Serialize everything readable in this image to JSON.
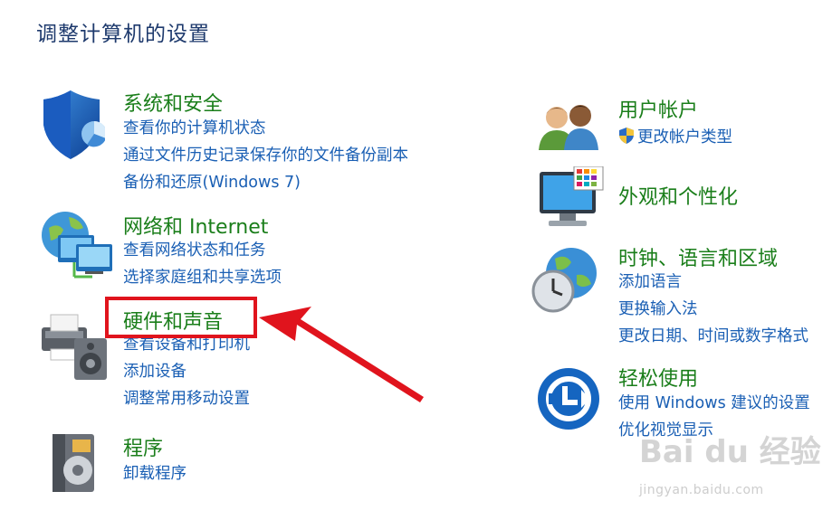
{
  "page": {
    "title": "调整计算机的设置"
  },
  "left_categories": [
    {
      "title": "系统和安全",
      "icon": "shield-icon",
      "links": [
        "查看你的计算机状态",
        "通过文件历史记录保存你的文件备份副本",
        "备份和还原(Windows 7)"
      ]
    },
    {
      "title": "网络和 Internet",
      "icon": "network-globe-icon",
      "links": [
        "查看网络状态和任务",
        "选择家庭组和共享选项"
      ]
    },
    {
      "title": "硬件和声音",
      "icon": "printer-speaker-icon",
      "links": [
        "查看设备和打印机",
        "添加设备",
        "调整常用移动设置"
      ]
    },
    {
      "title": "程序",
      "icon": "programs-disc-icon",
      "links": [
        "卸载程序"
      ]
    }
  ],
  "right_categories": [
    {
      "title": "用户帐户",
      "icon": "users-icon",
      "links": [
        "更改帐户类型"
      ],
      "link_icon": "uac-shield-icon"
    },
    {
      "title": "外观和个性化",
      "icon": "monitor-palette-icon",
      "links": []
    },
    {
      "title": "时钟、语言和区域",
      "icon": "clock-globe-icon",
      "links": [
        "添加语言",
        "更换输入法",
        "更改日期、时间或数字格式"
      ]
    },
    {
      "title": "轻松使用",
      "icon": "ease-of-access-icon",
      "links": [
        "使用 Windows 建议的设置",
        "优化视觉显示"
      ]
    }
  ],
  "annotation": {
    "highlight_color": "#e0141d",
    "arrow_icon": "red-arrow-icon"
  },
  "watermark": {
    "logo_text": "Bai du 经验",
    "site": "jingyan.baidu.com"
  },
  "colors": {
    "title_green": "#1a7e1a",
    "link_blue": "#1a5fb4",
    "heading_navy": "#1e3a6d"
  }
}
